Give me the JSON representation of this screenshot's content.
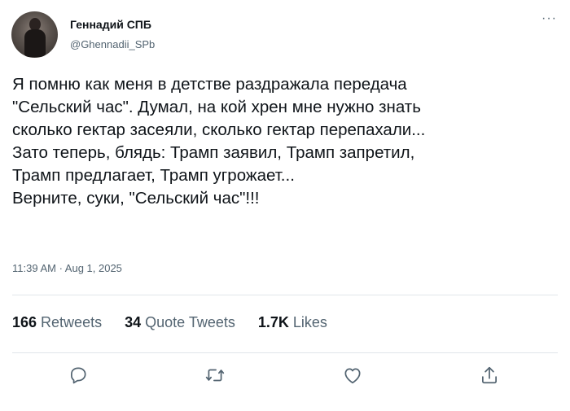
{
  "user": {
    "name": "Геннадий СПБ",
    "handle": "@Ghennadii_SPb"
  },
  "tweet": {
    "lines": [
      "Я помню как меня в детстве раздражала передача",
      "\"Сельский час\". Думал, на кой хрен мне нужно знать",
      "сколько гектар засеяли, сколько гектар перепахали...",
      "Зато теперь, блядь: Трамп заявил, Трамп запретил,",
      "Трамп предлагает, Трамп угрожает...",
      "Верните, суки, \"Сельский час\"!!!"
    ],
    "timestamp": "11:39 AM · Aug 1, 2025"
  },
  "stats": {
    "retweets": {
      "count": "166",
      "label": "Retweets"
    },
    "quotes": {
      "count": "34",
      "label": "Quote Tweets"
    },
    "likes": {
      "count": "1.7K",
      "label": "Likes"
    }
  },
  "icons": {
    "more": "more-icon",
    "reply": "reply-icon",
    "retweet": "retweet-icon",
    "like": "heart-icon",
    "share": "share-icon"
  },
  "colors": {
    "text": "#0f1419",
    "secondary": "#536471",
    "divider": "#e1e6ea"
  }
}
